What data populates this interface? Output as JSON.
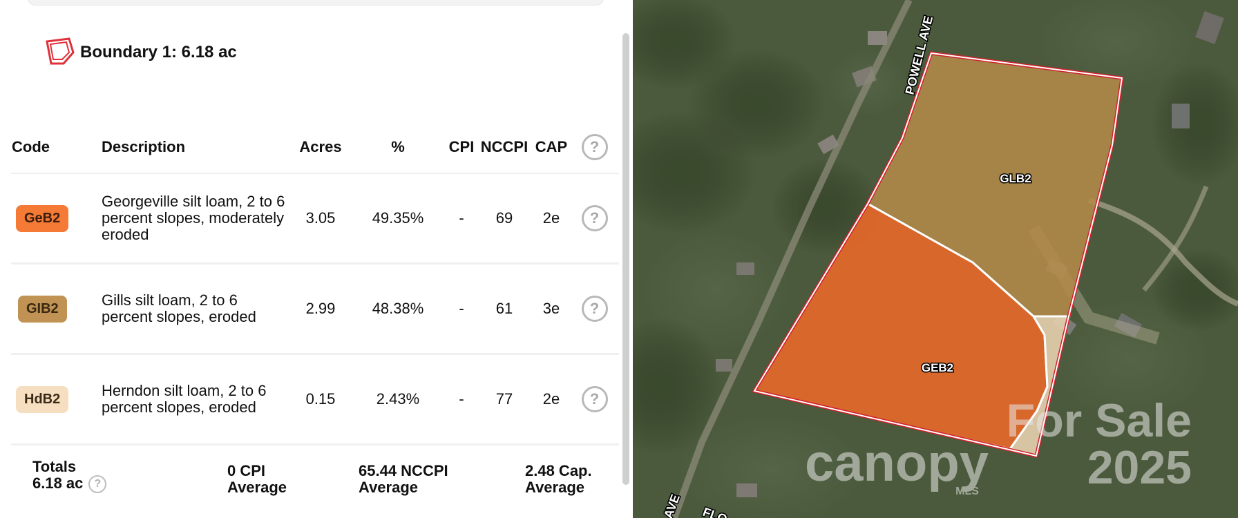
{
  "boundary": {
    "title": "Boundary 1: 6.18 ac",
    "outline_color": "#e0303a"
  },
  "table": {
    "headers": [
      "Code",
      "Description",
      "Acres",
      "%",
      "CPI",
      "NCCPI",
      "CAP"
    ],
    "rows": [
      {
        "code": "GeB2",
        "color": "#f47a35",
        "description": "Georgeville silt loam, 2 to 6 percent slopes, moderately eroded",
        "acres": "3.05",
        "percent": "49.35%",
        "cpi": "-",
        "nccpi": "69",
        "cap": "2e"
      },
      {
        "code": "GIB2",
        "color": "#c09254",
        "description": "Gills silt loam, 2 to 6 percent slopes, eroded",
        "acres": "2.99",
        "percent": "48.38%",
        "cpi": "-",
        "nccpi": "61",
        "cap": "3e"
      },
      {
        "code": "HdB2",
        "color": "#f6dfc0",
        "description": "Herndon silt loam, 2 to 6 percent slopes, eroded",
        "acres": "0.15",
        "percent": "2.43%",
        "cpi": "-",
        "nccpi": "77",
        "cap": "2e"
      }
    ]
  },
  "totals": {
    "label": "Totals",
    "acres": "6.18 ac",
    "cpi_value": "0 CPI",
    "cpi_sub": "Average",
    "nccpi_value": "65.44 NCCPI",
    "nccpi_sub": "Average",
    "cap_value": "2.48 Cap.",
    "cap_sub": "Average"
  },
  "map": {
    "street_labels": [
      "POWELL AVE",
      "AVE",
      "FLO"
    ],
    "polygon_labels": [
      "GLB2",
      "GEB2"
    ],
    "watermark": {
      "line1": "For Sale",
      "brand": "canopy",
      "brand_sub": "MLS",
      "year": "2025"
    },
    "colors": {
      "glb2": "#b38a4a",
      "geb2": "#e8682a",
      "hdb2": "#e6cfae",
      "boundary": "#d0222a"
    }
  }
}
